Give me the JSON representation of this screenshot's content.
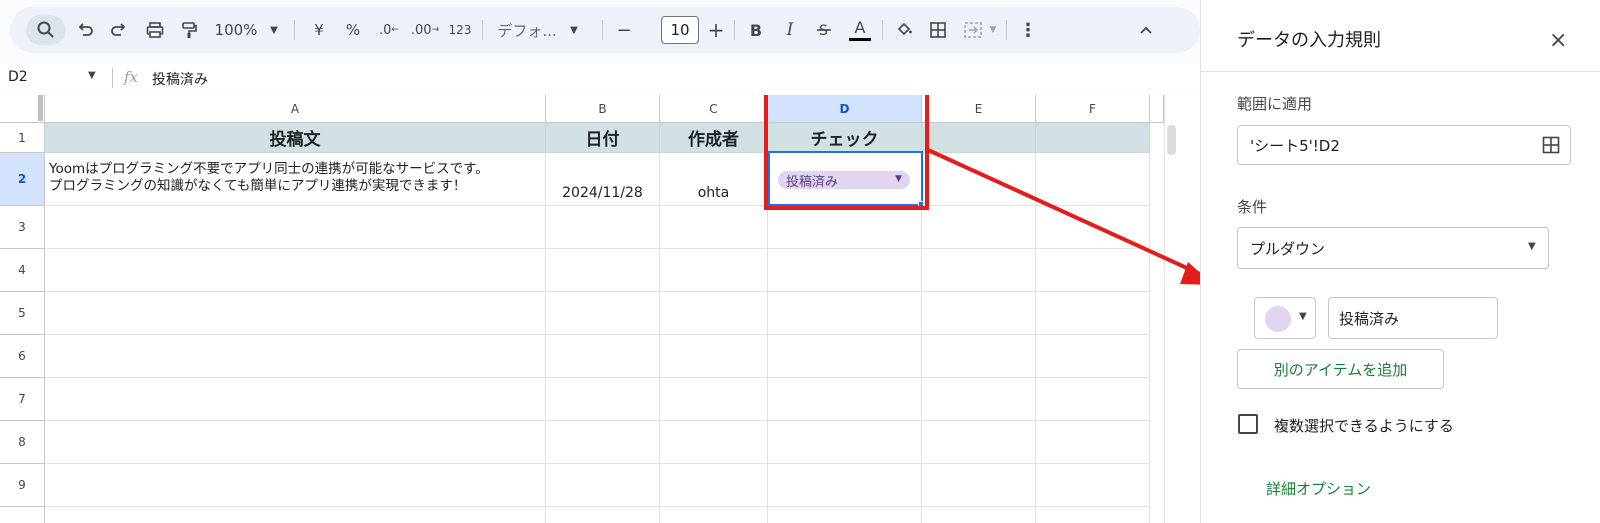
{
  "toolbar": {
    "zoom": "100%",
    "currency": "¥",
    "percent": "%",
    "dec_decrease": ".0",
    "dec_increase": ".00",
    "number_format": "123",
    "font": "デフォ...",
    "font_size": "10",
    "minus": "−",
    "plus": "+",
    "bold": "B",
    "italic": "I",
    "text_color_letter": "A"
  },
  "formula_bar": {
    "cell_ref": "D2",
    "fx": "fx",
    "value": "投稿済み"
  },
  "columns": [
    "A",
    "B",
    "C",
    "D",
    "E",
    "F"
  ],
  "rows": [
    "1",
    "2",
    "3",
    "4",
    "5",
    "6",
    "7",
    "8",
    "9"
  ],
  "sheet": {
    "headers": [
      "投稿文",
      "日付",
      "作成者",
      "チェック"
    ],
    "row2": {
      "post_line1": "Yoomはプログラミング不要でアプリ同士の連携が可能なサービスです。",
      "post_line2": "プログラミングの知識がなくても簡単にアプリ連携が実現できます！",
      "date": "2024/11/28",
      "author": "ohta",
      "check": "投稿済み"
    }
  },
  "panel": {
    "title": "データの入力規則",
    "range_label": "範囲に適用",
    "range_value": "'シート5'!D2",
    "condition_label": "条件",
    "condition_value": "プルダウン",
    "item_value": "投稿済み",
    "add_item": "別のアイテムを追加",
    "multi_select": "複数選択できるようにする",
    "advanced": "詳細オプション"
  },
  "colors": {
    "chip": "#e1d5f0",
    "chip_text": "#5b3e83",
    "header_fill": "#d0e0e3",
    "highlight": "#e31c1c",
    "selection": "#1a73e8"
  }
}
